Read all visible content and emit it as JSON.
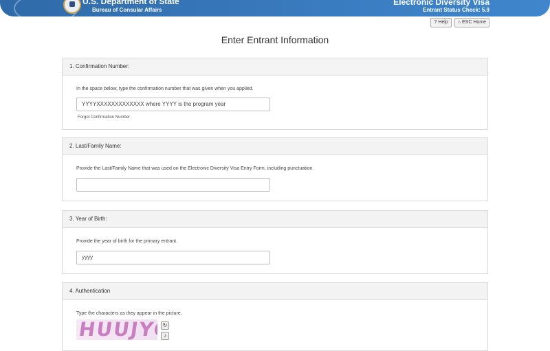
{
  "header": {
    "department": "U.S. Department of State",
    "bureau": "Bureau of Consular Affairs",
    "app_title": "Electronic Diversity Visa",
    "app_subtitle": "Entrant Status Check: 5.9"
  },
  "top_buttons": {
    "help_label": "Help",
    "home_label": "ESC Home"
  },
  "page": {
    "title": "Enter Entrant Information"
  },
  "sections": {
    "confirmation": {
      "heading": "1. Confirmation Number:",
      "instruction": "In the space below, type the confirmation number that was given when you applied.",
      "field_value": "YYYYXXXXXXXXXXXXX where YYYY is the program year",
      "forgot_link": "Forgot Confirmation Number"
    },
    "last_name": {
      "heading": "2. Last/Family Name:",
      "instruction": "Provide the Last/Family Name that was used on the Electronic Diversity Visa Entry Form, including punctuation.",
      "field_value": ""
    },
    "year_of_birth": {
      "heading": "3. Year of Birth:",
      "instruction": "Provide the year of birth for the primary entrant.",
      "field_value": "yyyy"
    },
    "authentication": {
      "heading": "4. Authentication",
      "instruction": "Type the characters as they appear in the picture.",
      "captcha_text": "HUUJYC"
    }
  },
  "colors": {
    "banner": "#3a7cc0",
    "panel_header": "#f3f3f3",
    "captcha_text": "#c97fbf"
  }
}
